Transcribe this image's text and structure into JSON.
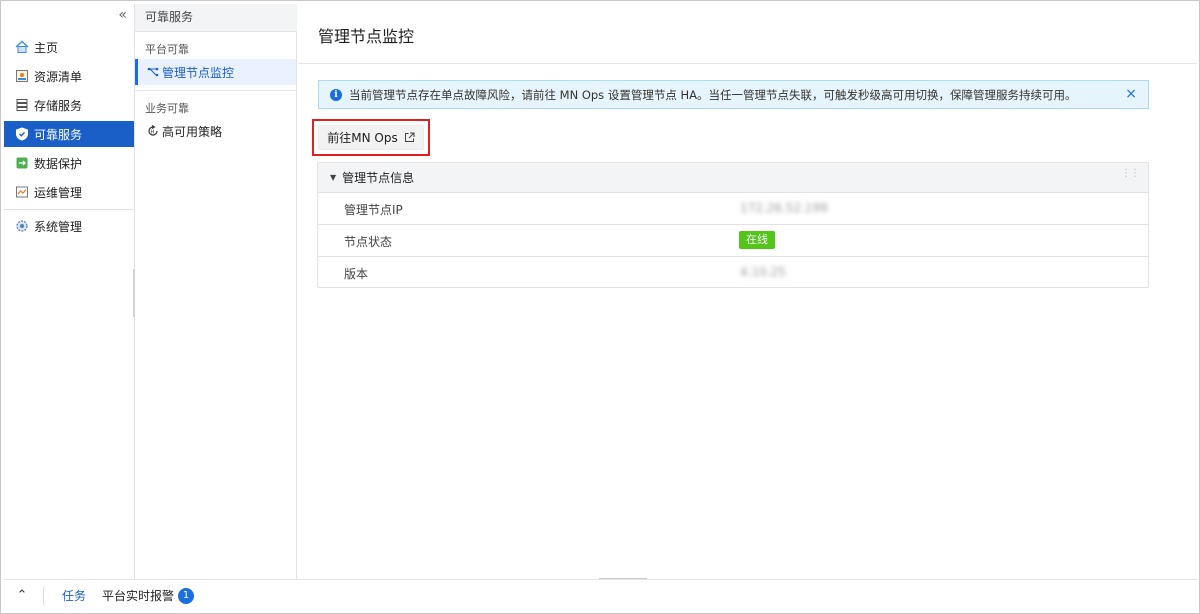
{
  "nav": {
    "collapse_icon": "double-chevron-left-icon",
    "items": [
      {
        "label": "主页",
        "icon": "home-icon"
      },
      {
        "label": "资源清单",
        "icon": "inventory-icon"
      },
      {
        "label": "存储服务",
        "icon": "storage-icon"
      },
      {
        "label": "可靠服务",
        "icon": "shield-icon",
        "active": true
      },
      {
        "label": "数据保护",
        "icon": "data-protection-icon"
      },
      {
        "label": "运维管理",
        "icon": "ops-icon"
      },
      {
        "label": "系统管理",
        "icon": "gear-icon"
      }
    ]
  },
  "subnav": {
    "title": "可靠服务",
    "group1": "平台可靠",
    "item_monitor": "管理节点监控",
    "group2": "业务可靠",
    "item_ha": "高可用策略"
  },
  "main": {
    "title": "管理节点监控",
    "alert_text": "当前管理节点存在单点故障风险，请前往 MN Ops 设置管理节点 HA。当任一管理节点失联，可触发秒级高可用切换，保障管理服务持续可用。",
    "alert_close": "×",
    "goto_button": "前往MN Ops",
    "card_title": "管理节点信息",
    "rows": [
      {
        "key": "管理节点IP",
        "value": "172.26.52.199"
      },
      {
        "key": "节点状态",
        "value": "在线"
      },
      {
        "key": "版本",
        "value": "4.10.25"
      }
    ]
  },
  "bottom": {
    "task": "任务",
    "alarm": "平台实时报警",
    "alarm_count": "1"
  },
  "colors": {
    "accent": "#1a5fc8",
    "highlight_border": "#e02020",
    "online": "#52c41a",
    "alert_bg": "#e6f4fb"
  }
}
